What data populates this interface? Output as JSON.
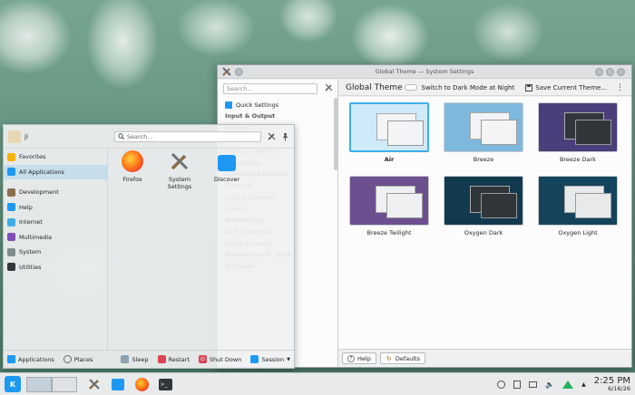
{
  "colors": {
    "accent": "#3daee9",
    "selection": "#c9e6f6"
  },
  "settings": {
    "title": "Global Theme — System Settings",
    "search_placeholder": "Search...",
    "sidebar": [
      {
        "label": "Quick Settings",
        "type": "item"
      },
      {
        "label": "Input & Output",
        "type": "header"
      },
      {
        "label": "Keyboard",
        "type": "item"
      },
      {
        "label": "Sound",
        "type": "item"
      },
      {
        "label": "Display & Monitor",
        "type": "item"
      },
      {
        "label": "Accessibility",
        "type": "item"
      },
      {
        "label": "Connected Devices",
        "type": "header"
      },
      {
        "label": "Bluetooth",
        "type": "item"
      },
      {
        "label": "Disks & Cameras",
        "type": "item"
      },
      {
        "label": "Printers",
        "type": "item"
      },
      {
        "label": "Networking",
        "type": "header"
      },
      {
        "label": "Wi-Fi & Internet",
        "type": "item"
      },
      {
        "label": "Online Accounts",
        "type": "item"
      },
      {
        "label": "Appearance & Style",
        "type": "header"
      },
      {
        "label": "Wallpaper",
        "type": "item"
      }
    ],
    "page_title": "Global Theme",
    "dark_mode_label": "Switch to Dark Mode at Night",
    "save_label": "Save Current Theme...",
    "themes": [
      {
        "name": "Air",
        "selected": true,
        "bg": "#9ccbe9",
        "wbg": "#f3f4f5"
      },
      {
        "name": "Breeze",
        "selected": false,
        "bg": "#7fb8dd",
        "wbg": "#f3f4f5"
      },
      {
        "name": "Breeze Dark",
        "selected": false,
        "bg": "#4a3f7a",
        "wbg": "#31363b"
      },
      {
        "name": "Breeze Twilight",
        "selected": false,
        "bg": "#6b4f8f",
        "wbg": "#eff0f1"
      },
      {
        "name": "Oxygen Dark",
        "selected": false,
        "bg": "#123a4e",
        "wbg": "#2f3538"
      },
      {
        "name": "Oxygen Light",
        "selected": false,
        "bg": "#14445b",
        "wbg": "#e7e9ea"
      }
    ],
    "help_label": "Help",
    "defaults_label": "Defaults"
  },
  "launcher": {
    "user": "ji",
    "search_placeholder": "Search...",
    "categories": [
      {
        "label": "Favorites",
        "icon": "star-icon"
      },
      {
        "label": "All Applications",
        "icon": "grid-icon"
      },
      {
        "label": "Development",
        "icon": "code-icon"
      },
      {
        "label": "Help",
        "icon": "help-icon"
      },
      {
        "label": "Internet",
        "icon": "globe-icon"
      },
      {
        "label": "Multimedia",
        "icon": "multimedia-icon"
      },
      {
        "label": "System",
        "icon": "system-icon"
      },
      {
        "label": "Utilities",
        "icon": "utilities-icon"
      }
    ],
    "apps": [
      {
        "label": "Firefox",
        "icon": "firefox-icon"
      },
      {
        "label": "System Settings",
        "icon": "system-settings-icon"
      },
      {
        "label": "Discover",
        "icon": "discover-icon"
      }
    ],
    "footer": {
      "applications": "Applications",
      "places": "Places",
      "sleep": "Sleep",
      "restart": "Restart",
      "shutdown": "Shut Down",
      "session": "Session"
    }
  },
  "taskbar": {
    "time": "2:25 PM",
    "date": "6/16/26"
  }
}
